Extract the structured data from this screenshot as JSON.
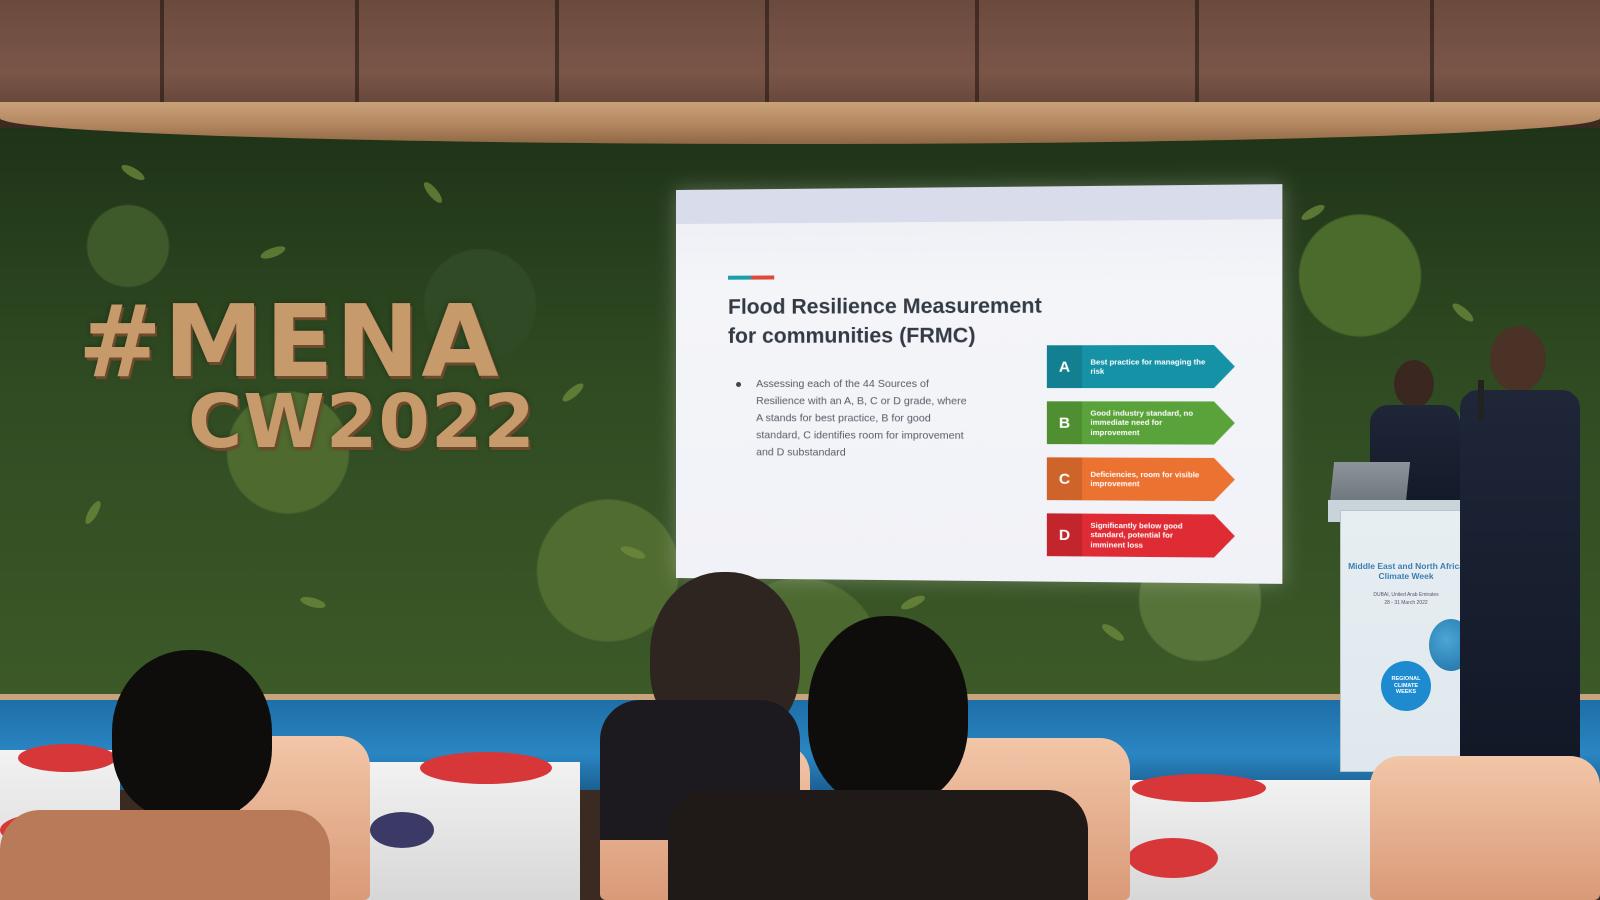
{
  "backdrop_sign": {
    "line1": "#MENA",
    "line2": "CW2022",
    "color": "#c69a6b"
  },
  "slide": {
    "title_line1": "Flood Resilience Measurement",
    "title_line2": "for communities (FRMC)",
    "bullet": "Assessing each of the 44 Sources of Resilience with an A, B, C or D grade, where A stands for best practice, B for good standard, C identifies room for improvement and D substandard",
    "grades": [
      {
        "letter": "A",
        "text": "Best practice for managing the risk",
        "color": "#1592a6"
      },
      {
        "letter": "B",
        "text": "Good industry standard, no immediate need for improvement",
        "color": "#5aa33a"
      },
      {
        "letter": "C",
        "text": "Deficiencies, room for visible improvement",
        "color": "#ec7232"
      },
      {
        "letter": "D",
        "text": "Significantly below good standard, potential for imminent loss",
        "color": "#df2b33"
      }
    ]
  },
  "podium": {
    "title": "Middle East and North Africa Climate Week",
    "location": "DUBAI, United Arab Emirates",
    "dates": "28 - 31 March 2022",
    "badge": "REGIONAL CLIMATE WEEKS"
  }
}
